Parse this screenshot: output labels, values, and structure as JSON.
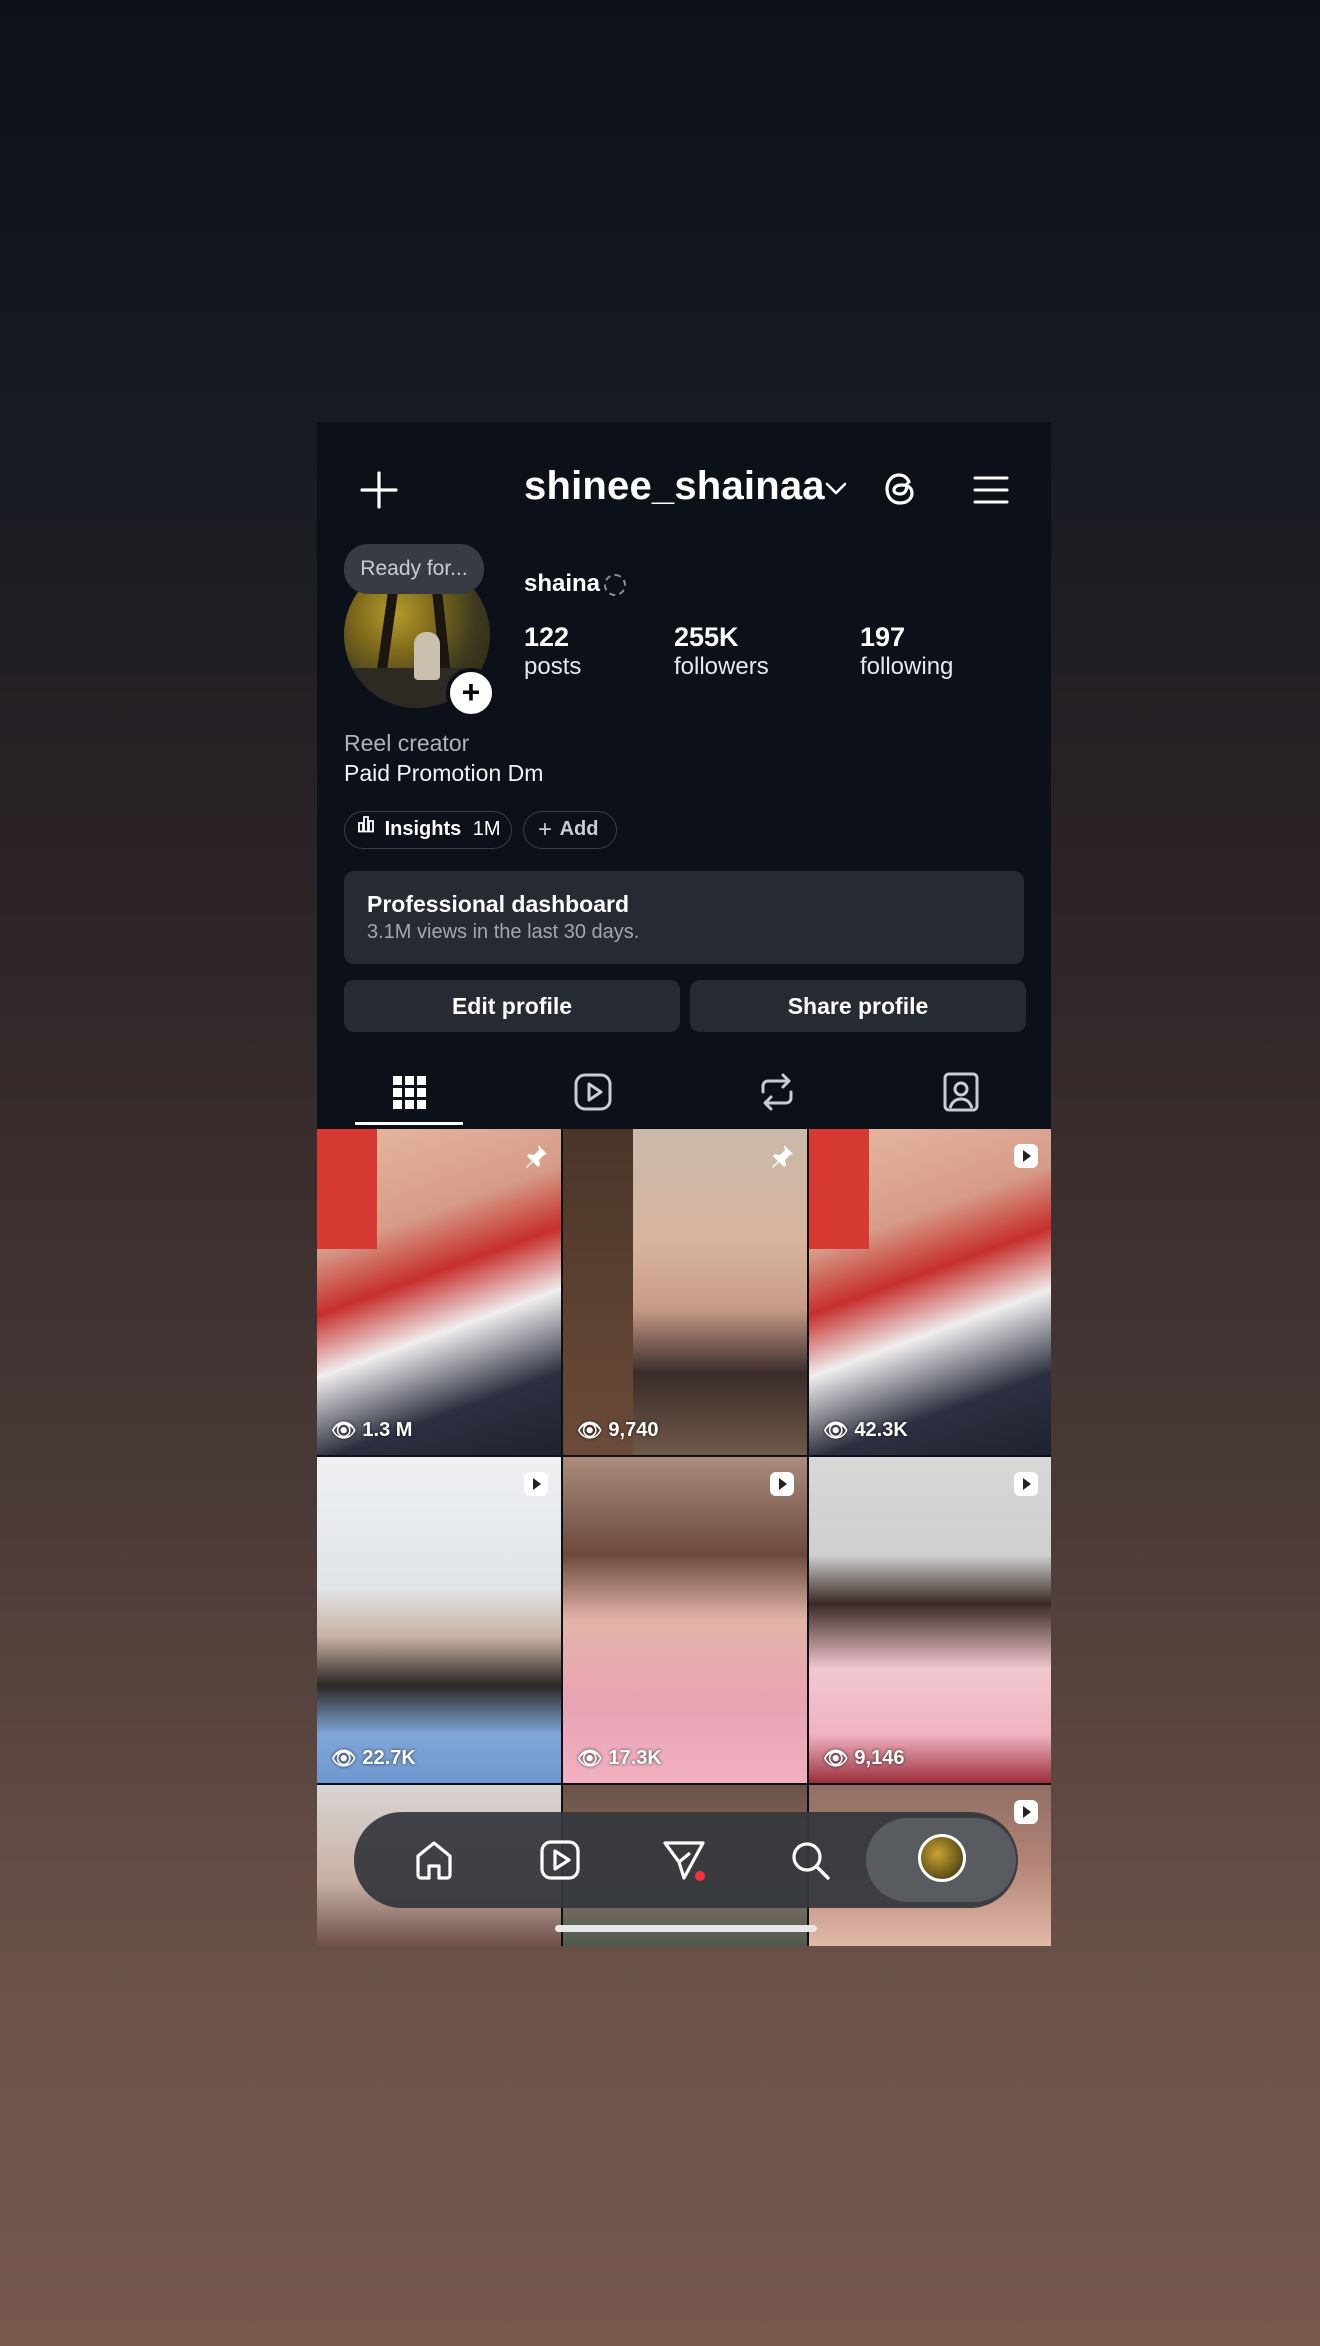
{
  "header": {
    "username": "shinee_shainaa"
  },
  "profile": {
    "note": "Ready for...",
    "display_name": "shaina",
    "stats": [
      {
        "value": "122",
        "label": "posts"
      },
      {
        "value": "255K",
        "label": "followers"
      },
      {
        "value": "197",
        "label": "following"
      }
    ],
    "bio_category": "Reel creator",
    "bio_text": "Paid Promotion Dm",
    "insights_label": "Insights",
    "insights_value": "1M",
    "add_label": "Add"
  },
  "dashboard": {
    "title": "Professional dashboard",
    "subtitle": "3.1M views in the last 30 days."
  },
  "buttons": {
    "edit": "Edit profile",
    "share": "Share profile"
  },
  "tabs": [
    "grid-icon",
    "reels-icon",
    "reposts-icon",
    "tagged-icon"
  ],
  "grid": [
    {
      "views": "1.3 M",
      "badge": "pin-icon"
    },
    {
      "views": "9,740",
      "badge": "pin-icon"
    },
    {
      "views": "42.3K",
      "badge": "reel-icon"
    },
    {
      "views": "22.7K",
      "badge": "reel-icon"
    },
    {
      "views": "17.3K",
      "badge": "reel-icon"
    },
    {
      "views": "9,146",
      "badge": "reel-icon"
    },
    {
      "views": "",
      "badge": "reel-icon"
    },
    {
      "views": "",
      "badge": "reel-icon"
    },
    {
      "views": "",
      "badge": "reel-icon"
    }
  ],
  "nav": [
    "home-icon",
    "reels-icon",
    "messages-icon",
    "search-icon",
    "profile-avatar"
  ],
  "colors": {
    "background": "#0c1119",
    "surface": "#262b33",
    "notification_dot": "#ff3040"
  }
}
